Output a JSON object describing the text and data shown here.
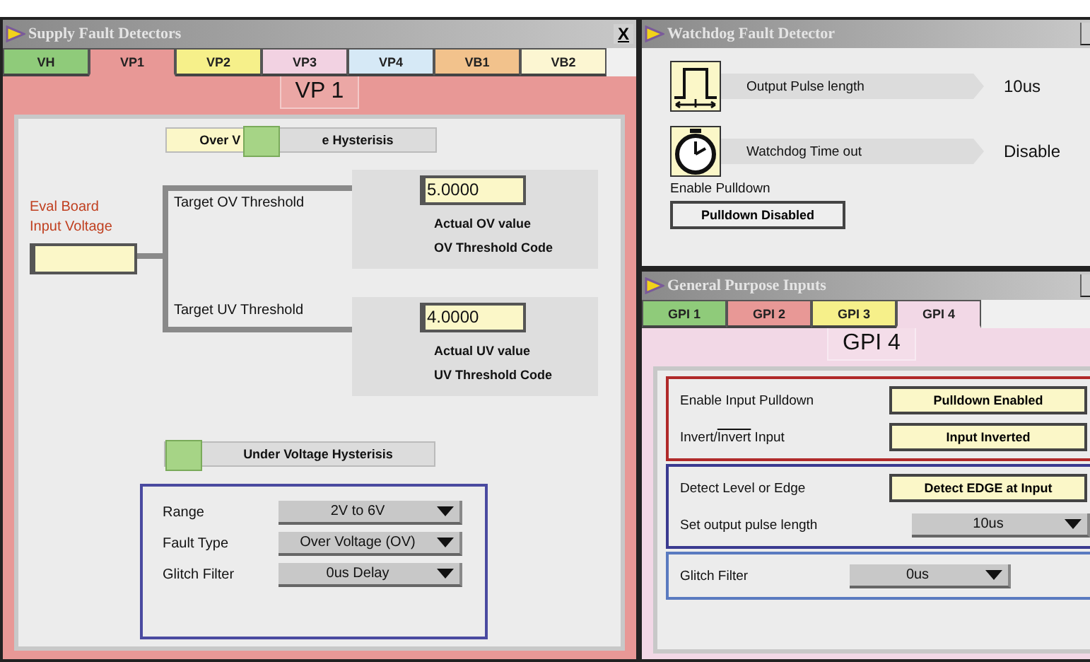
{
  "supply_window": {
    "title": "Supply Fault Detectors",
    "close": "X",
    "tabs": [
      {
        "label": "VH",
        "color": "#8fcb7a",
        "selected": false
      },
      {
        "label": "VP1",
        "color": "#e89896",
        "selected": true
      },
      {
        "label": "VP2",
        "color": "#f6f08a",
        "selected": false
      },
      {
        "label": "VP3",
        "color": "#f2d2e2",
        "selected": false
      },
      {
        "label": "VP4",
        "color": "#d6e9f6",
        "selected": false
      },
      {
        "label": "VB1",
        "color": "#f2c28c",
        "selected": false
      },
      {
        "label": "VB2",
        "color": "#fcf6d2",
        "selected": false
      }
    ],
    "panel_title": "VP 1",
    "ov_slider": {
      "label_left": "Over V",
      "label_right": "e Hysterisis",
      "level": 0.33
    },
    "input_label": "Eval Board Input Voltage",
    "thresholds": [
      {
        "label": "Target OV Threshold",
        "value": "5.0000",
        "readouts": [
          "Actual OV  value",
          "OV Threshold Code"
        ]
      },
      {
        "label": "Target UV Threshold",
        "value": "4.0000",
        "readouts": [
          "Actual UV  value",
          "UV Threshold Code"
        ]
      }
    ],
    "uv_slider": {
      "label_right": "Under Voltage Hysterisis",
      "level": 0
    },
    "settings": [
      {
        "label": "Range",
        "value": "2V to 6V"
      },
      {
        "label": "Fault Type",
        "value": "Over Voltage (OV)"
      },
      {
        "label": "Glitch Filter",
        "value": "0us Delay"
      }
    ]
  },
  "watchdog_window": {
    "title": "Watchdog Fault Detector",
    "rows": [
      {
        "kind": "pulse",
        "label": "Output Pulse length",
        "value": "10us"
      },
      {
        "kind": "timer",
        "label": "Watchdog Time out",
        "value": "Disable"
      }
    ],
    "pulldown_label": "Enable Pulldown",
    "pulldown_button": "Pulldown Disabled"
  },
  "gpi_window": {
    "title": "General Purpose Inputs",
    "tabs": [
      {
        "label": "GPI 1",
        "color": "#8fcb7a",
        "selected": false
      },
      {
        "label": "GPI 2",
        "color": "#e89896",
        "selected": false
      },
      {
        "label": "GPI 3",
        "color": "#f6f08a",
        "selected": false
      },
      {
        "label": "GPI 4",
        "color": "#f2d8e6",
        "selected": true
      }
    ],
    "panel_title": "GPI 4",
    "groups": [
      {
        "color": "#b02a2a",
        "rows": [
          {
            "kind": "toggle",
            "label": "Enable Input Pulldown",
            "value": "Pulldown Enabled"
          },
          {
            "kind": "toggle",
            "label_pre": "Invert/",
            "label_bar": "Invert",
            "label_post": " Input",
            "value": "Input Inverted"
          }
        ]
      },
      {
        "color": "#3a3a90",
        "rows": [
          {
            "kind": "toggle",
            "label": "Detect Level or Edge",
            "value": "Detect EDGE at Input"
          },
          {
            "kind": "dropdown",
            "label": "Set output pulse length",
            "value": "10us"
          }
        ]
      },
      {
        "color": "#5a7ac0",
        "rows": [
          {
            "kind": "dropdown",
            "label": "Glitch Filter",
            "value": "0us"
          }
        ]
      }
    ]
  }
}
